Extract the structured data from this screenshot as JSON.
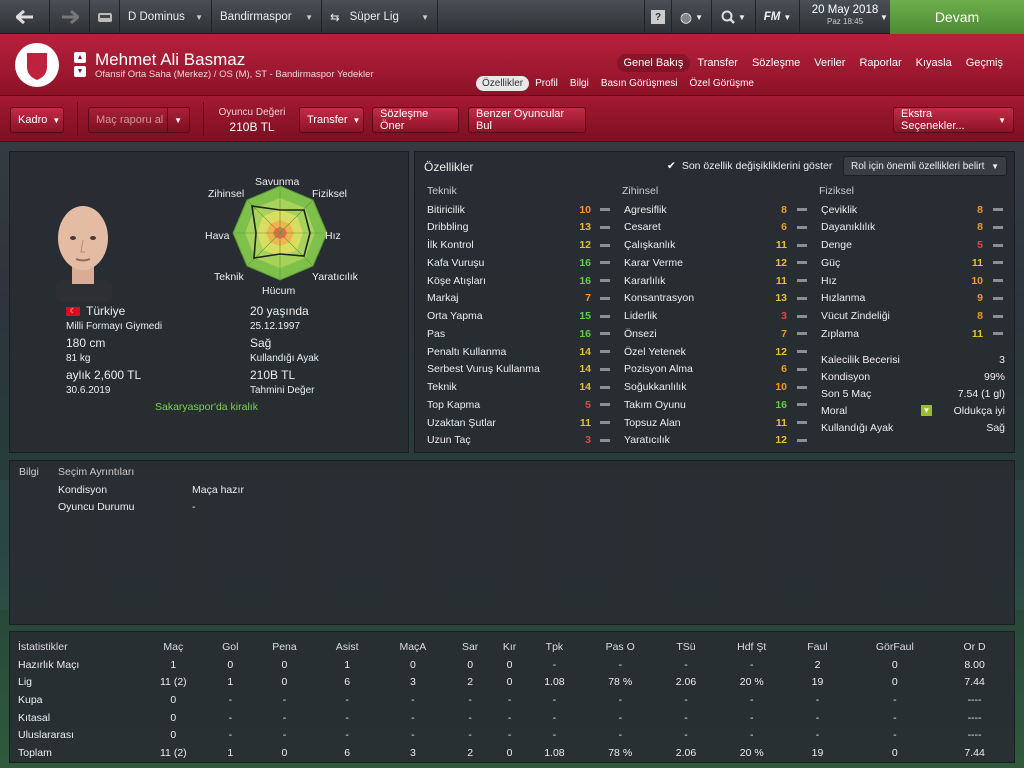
{
  "topbar": {
    "club": "D Dominus",
    "league_team": "Bandirmaspor",
    "competition": "Süper Lig",
    "fm": "FM",
    "date": "20 May 2018",
    "date_sub": "Paz 18:45",
    "continue": "Devam"
  },
  "player": {
    "name": "Mehmet Ali Basmaz",
    "position": "Ofansif Orta Saha (Merkez) / OS (M), ST - Bandirmaspor Yedekler"
  },
  "nav": {
    "main": [
      "Genel Bakış",
      "Transfer",
      "Sözleşme",
      "Veriler",
      "Raporlar",
      "Kıyasla",
      "Geçmiş"
    ],
    "sub": [
      "Özellikler",
      "Profil",
      "Bilgi",
      "Basın Görüşmesi",
      "Özel Görüşme"
    ]
  },
  "toolbar": {
    "squad": "Kadro",
    "match_report": "Maç raporu al",
    "value_label": "Oyuncu Değeri",
    "value": "210B TL",
    "transfer": "Transfer",
    "offer": "Sözleşme Öner",
    "similar": "Benzer Oyuncular Bul",
    "extra": "Ekstra Seçenekler..."
  },
  "radar": {
    "labels": [
      "Savunma",
      "Fiziksel",
      "Hız",
      "Yaratıcılık",
      "Hücum",
      "Teknik",
      "Hava",
      "Zihinsel"
    ],
    "values": [
      0.35,
      0.45,
      0.55,
      0.35,
      0.3,
      0.5,
      0.3,
      0.55
    ]
  },
  "card": {
    "nation": "Türkiye",
    "intl": "Milli Formayı Giymedi",
    "height": "180 cm",
    "weight": "81 kg",
    "wage": "aylık 2,600 TL",
    "expiry": "30.6.2019",
    "age": "20 yaşında",
    "dob": "25.12.1997",
    "foot": "Sağ",
    "foot_label": "Kullandığı Ayak",
    "value": "210B TL",
    "value_label": "Tahmini Değer",
    "loan": "Sakaryaspor'da kiralık"
  },
  "attrs": {
    "title": "Özellikler",
    "show_changes": "Son özellik değişikliklerini göster",
    "role": "Rol için önemli özellikleri belirt",
    "tech_h": "Teknik",
    "ment_h": "Zihinsel",
    "phys_h": "Fiziksel",
    "tech": [
      [
        "Bitiricilik",
        "10",
        "o"
      ],
      [
        "Dribbling",
        "13",
        "y"
      ],
      [
        "İlk Kontrol",
        "12",
        "y"
      ],
      [
        "Kafa Vuruşu",
        "16",
        "g"
      ],
      [
        "Köşe Atışları",
        "16",
        "g"
      ],
      [
        "Markaj",
        "7",
        "o"
      ],
      [
        "Orta Yapma",
        "15",
        "g"
      ],
      [
        "Pas",
        "16",
        "g"
      ],
      [
        "Penaltı Kullanma",
        "14",
        "y"
      ],
      [
        "Serbest Vuruş Kullanma",
        "14",
        "y"
      ],
      [
        "Teknik",
        "14",
        "y"
      ],
      [
        "Top Kapma",
        "5",
        "r"
      ],
      [
        "Uzaktan Şutlar",
        "11",
        "y"
      ],
      [
        "Uzun Taç",
        "3",
        "r"
      ]
    ],
    "ment": [
      [
        "Agresiflik",
        "8",
        "o"
      ],
      [
        "Cesaret",
        "6",
        "o"
      ],
      [
        "Çalışkanlık",
        "11",
        "y"
      ],
      [
        "Karar Verme",
        "12",
        "y"
      ],
      [
        "Kararlılık",
        "11",
        "y"
      ],
      [
        "Konsantrasyon",
        "13",
        "y"
      ],
      [
        "Liderlik",
        "3",
        "r"
      ],
      [
        "Önsezi",
        "7",
        "o"
      ],
      [
        "Özel Yetenek",
        "12",
        "y"
      ],
      [
        "Pozisyon Alma",
        "6",
        "o"
      ],
      [
        "Soğukkanlılık",
        "10",
        "o"
      ],
      [
        "Takım Oyunu",
        "16",
        "g"
      ],
      [
        "Topsuz Alan",
        "11",
        "y"
      ],
      [
        "Yaratıcılık",
        "12",
        "y"
      ]
    ],
    "phys": [
      [
        "Çeviklik",
        "8",
        "o"
      ],
      [
        "Dayanıklılık",
        "8",
        "o"
      ],
      [
        "Denge",
        "5",
        "r"
      ],
      [
        "Güç",
        "11",
        "y"
      ],
      [
        "Hız",
        "10",
        "o"
      ],
      [
        "Hızlanma",
        "9",
        "o"
      ],
      [
        "Vücut Zindeliği",
        "8",
        "o"
      ],
      [
        "Zıplama",
        "11",
        "y"
      ]
    ],
    "extra": [
      [
        "Kalecilik Becerisi",
        "3"
      ],
      [
        "Kondisyon",
        "99%"
      ],
      [
        "Son 5 Maç",
        "7.54 (1 gl)"
      ],
      [
        "Moral",
        "Oldukça iyi"
      ],
      [
        "Kullandığı Ayak",
        "Sağ"
      ]
    ]
  },
  "info": {
    "title": "Bilgi",
    "sel": "Seçim Ayrıntıları",
    "cond_l": "Kondisyon",
    "cond_v": "Maça hazır",
    "stat_l": "Oyuncu Durumu",
    "stat_v": "-"
  },
  "stats": {
    "headers": [
      "İstatistikler",
      "Maç",
      "Gol",
      "Pena",
      "Asist",
      "MaçA",
      "Sar",
      "Kır",
      "Tpk",
      "Pas O",
      "TSü",
      "Hdf Şt",
      "Faul",
      "GörFaul",
      "Or D"
    ],
    "rows": [
      [
        "Hazırlık Maçı",
        "1",
        "0",
        "0",
        "1",
        "0",
        "0",
        "0",
        "-",
        "-",
        "-",
        "-",
        "2",
        "0",
        "8.00"
      ],
      [
        "Lig",
        "11 (2)",
        "1",
        "0",
        "6",
        "3",
        "2",
        "0",
        "1.08",
        "78 %",
        "2.06",
        "20 %",
        "19",
        "0",
        "7.44"
      ],
      [
        "Kupa",
        "0",
        "-",
        "-",
        "-",
        "-",
        "-",
        "-",
        "-",
        "-",
        "-",
        "-",
        "-",
        "-",
        "----"
      ],
      [
        "Kıtasal",
        "0",
        "-",
        "-",
        "-",
        "-",
        "-",
        "-",
        "-",
        "-",
        "-",
        "-",
        "-",
        "-",
        "----"
      ],
      [
        "Uluslararası",
        "0",
        "-",
        "-",
        "-",
        "-",
        "-",
        "-",
        "-",
        "-",
        "-",
        "-",
        "-",
        "-",
        "----"
      ],
      [
        "Toplam",
        "11 (2)",
        "1",
        "0",
        "6",
        "3",
        "2",
        "0",
        "1.08",
        "78 %",
        "2.06",
        "20 %",
        "19",
        "0",
        "7.44"
      ]
    ]
  }
}
